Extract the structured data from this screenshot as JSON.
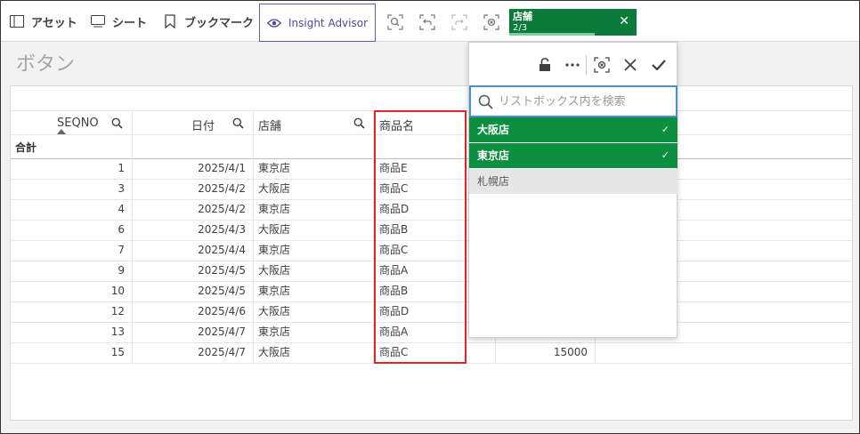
{
  "toolbar": {
    "assets_label": "アセット",
    "sheets_label": "シート",
    "bookmarks_label": "ブックマーク",
    "insight_advisor_label": "Insight Advisor"
  },
  "selection_pill": {
    "field": "店舗",
    "count": "2/3"
  },
  "sheet": {
    "title": "ボタン"
  },
  "table": {
    "headers": [
      "SEQNO",
      "日付",
      "店舗",
      "商品名"
    ],
    "total_label": "合計",
    "rows": [
      {
        "seqno": "1",
        "date": "2025/4/1",
        "store": "東京店",
        "product": "商品E"
      },
      {
        "seqno": "3",
        "date": "2025/4/2",
        "store": "大阪店",
        "product": "商品C"
      },
      {
        "seqno": "4",
        "date": "2025/4/2",
        "store": "東京店",
        "product": "商品D"
      },
      {
        "seqno": "6",
        "date": "2025/4/3",
        "store": "大阪店",
        "product": "商品B"
      },
      {
        "seqno": "7",
        "date": "2025/4/4",
        "store": "東京店",
        "product": "商品C"
      },
      {
        "seqno": "9",
        "date": "2025/4/5",
        "store": "大阪店",
        "product": "商品A"
      },
      {
        "seqno": "10",
        "date": "2025/4/5",
        "store": "東京店",
        "product": "商品B"
      },
      {
        "seqno": "12",
        "date": "2025/4/6",
        "store": "大阪店",
        "product": "商品D"
      },
      {
        "seqno": "13",
        "date": "2025/4/7",
        "store": "東京店",
        "product": "商品A"
      },
      {
        "seqno": "15",
        "date": "2025/4/7",
        "store": "大阪店",
        "product": "商品C"
      }
    ],
    "last_row_amount": "15000"
  },
  "listbox": {
    "search_placeholder": "リストボックス内を検索",
    "options": [
      {
        "label": "大阪店",
        "state": "selected"
      },
      {
        "label": "東京店",
        "state": "selected"
      },
      {
        "label": "札幌店",
        "state": "alternative"
      }
    ]
  },
  "colors": {
    "selected_green": "#0c8f3f",
    "pill_green": "#0c7a3a",
    "highlight_red": "#e0262b",
    "insight_purple": "#5e5eb8"
  }
}
